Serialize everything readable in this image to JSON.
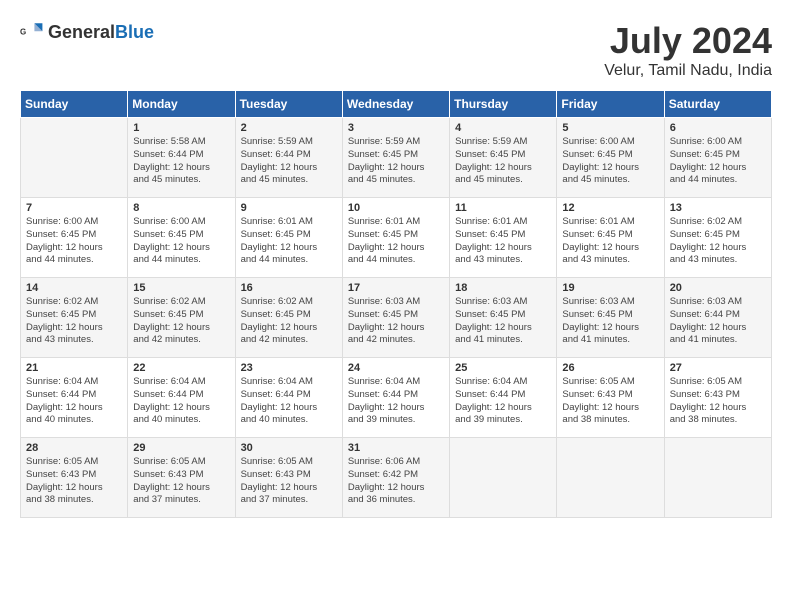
{
  "header": {
    "logo_general": "General",
    "logo_blue": "Blue",
    "title": "July 2024",
    "location": "Velur, Tamil Nadu, India"
  },
  "days_of_week": [
    "Sunday",
    "Monday",
    "Tuesday",
    "Wednesday",
    "Thursday",
    "Friday",
    "Saturday"
  ],
  "weeks": [
    [
      {
        "day": "",
        "content": ""
      },
      {
        "day": "1",
        "content": "Sunrise: 5:58 AM\nSunset: 6:44 PM\nDaylight: 12 hours\nand 45 minutes."
      },
      {
        "day": "2",
        "content": "Sunrise: 5:59 AM\nSunset: 6:44 PM\nDaylight: 12 hours\nand 45 minutes."
      },
      {
        "day": "3",
        "content": "Sunrise: 5:59 AM\nSunset: 6:45 PM\nDaylight: 12 hours\nand 45 minutes."
      },
      {
        "day": "4",
        "content": "Sunrise: 5:59 AM\nSunset: 6:45 PM\nDaylight: 12 hours\nand 45 minutes."
      },
      {
        "day": "5",
        "content": "Sunrise: 6:00 AM\nSunset: 6:45 PM\nDaylight: 12 hours\nand 45 minutes."
      },
      {
        "day": "6",
        "content": "Sunrise: 6:00 AM\nSunset: 6:45 PM\nDaylight: 12 hours\nand 44 minutes."
      }
    ],
    [
      {
        "day": "7",
        "content": "Sunrise: 6:00 AM\nSunset: 6:45 PM\nDaylight: 12 hours\nand 44 minutes."
      },
      {
        "day": "8",
        "content": "Sunrise: 6:00 AM\nSunset: 6:45 PM\nDaylight: 12 hours\nand 44 minutes."
      },
      {
        "day": "9",
        "content": "Sunrise: 6:01 AM\nSunset: 6:45 PM\nDaylight: 12 hours\nand 44 minutes."
      },
      {
        "day": "10",
        "content": "Sunrise: 6:01 AM\nSunset: 6:45 PM\nDaylight: 12 hours\nand 44 minutes."
      },
      {
        "day": "11",
        "content": "Sunrise: 6:01 AM\nSunset: 6:45 PM\nDaylight: 12 hours\nand 43 minutes."
      },
      {
        "day": "12",
        "content": "Sunrise: 6:01 AM\nSunset: 6:45 PM\nDaylight: 12 hours\nand 43 minutes."
      },
      {
        "day": "13",
        "content": "Sunrise: 6:02 AM\nSunset: 6:45 PM\nDaylight: 12 hours\nand 43 minutes."
      }
    ],
    [
      {
        "day": "14",
        "content": "Sunrise: 6:02 AM\nSunset: 6:45 PM\nDaylight: 12 hours\nand 43 minutes."
      },
      {
        "day": "15",
        "content": "Sunrise: 6:02 AM\nSunset: 6:45 PM\nDaylight: 12 hours\nand 42 minutes."
      },
      {
        "day": "16",
        "content": "Sunrise: 6:02 AM\nSunset: 6:45 PM\nDaylight: 12 hours\nand 42 minutes."
      },
      {
        "day": "17",
        "content": "Sunrise: 6:03 AM\nSunset: 6:45 PM\nDaylight: 12 hours\nand 42 minutes."
      },
      {
        "day": "18",
        "content": "Sunrise: 6:03 AM\nSunset: 6:45 PM\nDaylight: 12 hours\nand 41 minutes."
      },
      {
        "day": "19",
        "content": "Sunrise: 6:03 AM\nSunset: 6:45 PM\nDaylight: 12 hours\nand 41 minutes."
      },
      {
        "day": "20",
        "content": "Sunrise: 6:03 AM\nSunset: 6:44 PM\nDaylight: 12 hours\nand 41 minutes."
      }
    ],
    [
      {
        "day": "21",
        "content": "Sunrise: 6:04 AM\nSunset: 6:44 PM\nDaylight: 12 hours\nand 40 minutes."
      },
      {
        "day": "22",
        "content": "Sunrise: 6:04 AM\nSunset: 6:44 PM\nDaylight: 12 hours\nand 40 minutes."
      },
      {
        "day": "23",
        "content": "Sunrise: 6:04 AM\nSunset: 6:44 PM\nDaylight: 12 hours\nand 40 minutes."
      },
      {
        "day": "24",
        "content": "Sunrise: 6:04 AM\nSunset: 6:44 PM\nDaylight: 12 hours\nand 39 minutes."
      },
      {
        "day": "25",
        "content": "Sunrise: 6:04 AM\nSunset: 6:44 PM\nDaylight: 12 hours\nand 39 minutes."
      },
      {
        "day": "26",
        "content": "Sunrise: 6:05 AM\nSunset: 6:43 PM\nDaylight: 12 hours\nand 38 minutes."
      },
      {
        "day": "27",
        "content": "Sunrise: 6:05 AM\nSunset: 6:43 PM\nDaylight: 12 hours\nand 38 minutes."
      }
    ],
    [
      {
        "day": "28",
        "content": "Sunrise: 6:05 AM\nSunset: 6:43 PM\nDaylight: 12 hours\nand 38 minutes."
      },
      {
        "day": "29",
        "content": "Sunrise: 6:05 AM\nSunset: 6:43 PM\nDaylight: 12 hours\nand 37 minutes."
      },
      {
        "day": "30",
        "content": "Sunrise: 6:05 AM\nSunset: 6:43 PM\nDaylight: 12 hours\nand 37 minutes."
      },
      {
        "day": "31",
        "content": "Sunrise: 6:06 AM\nSunset: 6:42 PM\nDaylight: 12 hours\nand 36 minutes."
      },
      {
        "day": "",
        "content": ""
      },
      {
        "day": "",
        "content": ""
      },
      {
        "day": "",
        "content": ""
      }
    ]
  ]
}
